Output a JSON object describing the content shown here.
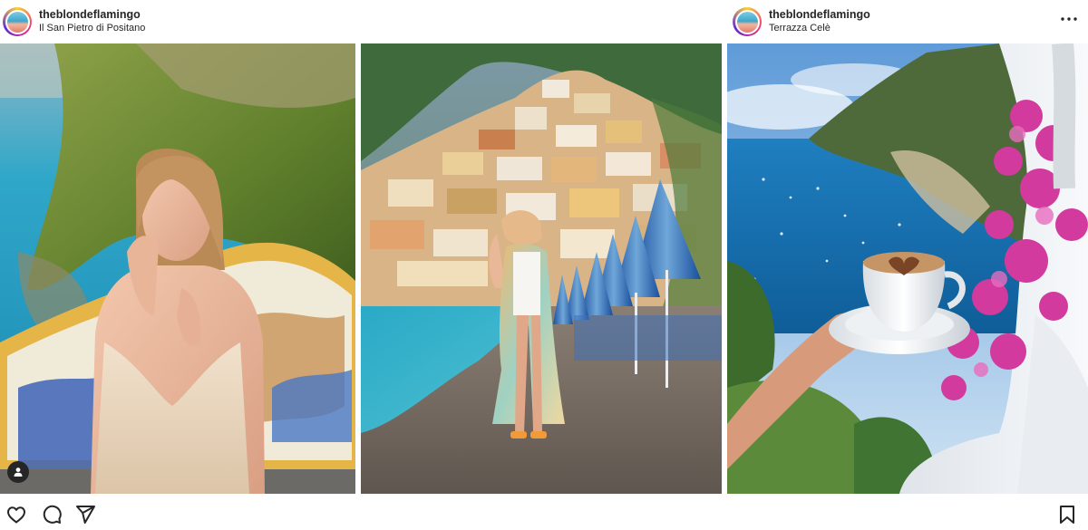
{
  "posts": [
    {
      "username": "theblondeflamingo",
      "location": "Il San Pietro di Positano"
    },
    {
      "username": "theblondeflamingo",
      "location": "Terrazza Celè"
    }
  ],
  "icons": {
    "more": "more-horizontal-icon",
    "tag": "user-tag-icon",
    "like": "heart-icon",
    "comment": "comment-icon",
    "share": "send-icon",
    "save": "bookmark-icon"
  },
  "colors": {
    "text": "#262626",
    "sea": "#1b8fc4",
    "story_ring": [
      "#f9ce34",
      "#ee2a7b",
      "#6228d7"
    ]
  }
}
